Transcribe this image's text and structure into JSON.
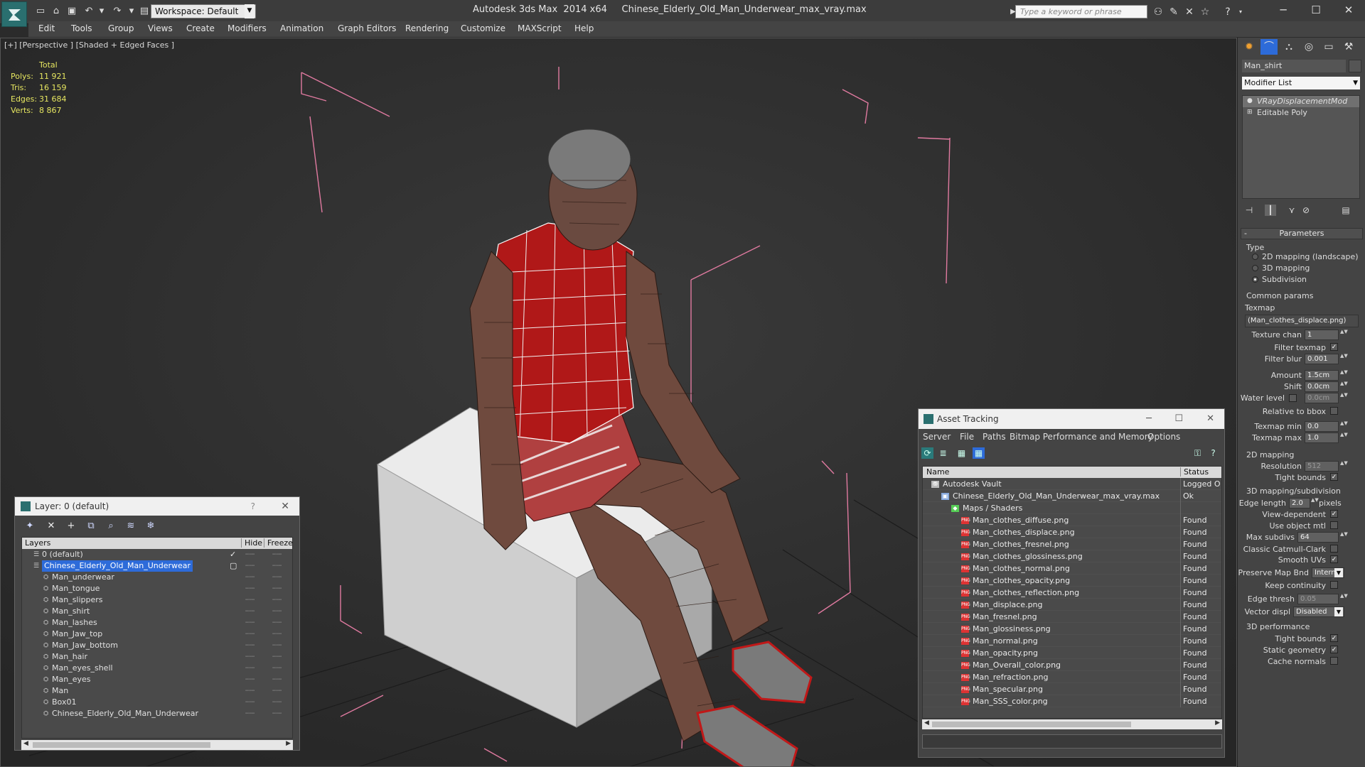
{
  "titlebar": {
    "workspace": "Workspace: Default",
    "app_title": "Autodesk 3ds Max  2014 x64     Chinese_Elderly_Old_Man_Underwear_max_vray.max",
    "search_placeholder": "Type a keyword or phrase"
  },
  "menu": [
    "Edit",
    "Tools",
    "Group",
    "Views",
    "Create",
    "Modifiers",
    "Animation",
    "Graph Editors",
    "Rendering",
    "Customize",
    "MAXScript",
    "Help"
  ],
  "viewport": {
    "label": "[+] [Perspective ] [Shaded + Edged Faces ]",
    "stats": {
      "total_label": "Total",
      "rows": [
        {
          "label": "Polys:",
          "value": "11 921"
        },
        {
          "label": "Tris:",
          "value": "16 159"
        },
        {
          "label": "Edges:",
          "value": "31 684"
        },
        {
          "label": "Verts:",
          "value": "8 867"
        }
      ]
    }
  },
  "layer_dialog": {
    "title": "Layer: 0 (default)",
    "help": "?",
    "columns": {
      "layers": "Layers",
      "hide": "Hide",
      "freeze": "Freeze"
    },
    "rows": [
      {
        "name": "0 (default)",
        "level": 1,
        "checked": true
      },
      {
        "name": "Chinese_Elderly_Old_Man_Underwear",
        "level": 1,
        "selected": true
      },
      {
        "name": "Man_underwear",
        "level": 2
      },
      {
        "name": "Man_tongue",
        "level": 2
      },
      {
        "name": "Man_slippers",
        "level": 2
      },
      {
        "name": "Man_shirt",
        "level": 2
      },
      {
        "name": "Man_lashes",
        "level": 2
      },
      {
        "name": "Man_Jaw_top",
        "level": 2
      },
      {
        "name": "Man_Jaw_bottom",
        "level": 2
      },
      {
        "name": "Man_hair",
        "level": 2
      },
      {
        "name": "Man_eyes_shell",
        "level": 2
      },
      {
        "name": "Man_eyes",
        "level": 2
      },
      {
        "name": "Man",
        "level": 2
      },
      {
        "name": "Box01",
        "level": 2
      },
      {
        "name": "Chinese_Elderly_Old_Man_Underwear",
        "level": 2
      }
    ]
  },
  "asset_dialog": {
    "title": "Asset Tracking",
    "menu": [
      "Server",
      "File",
      "Paths",
      "Bitmap Performance and Memory",
      "Options"
    ],
    "columns": {
      "name": "Name",
      "status": "Status"
    },
    "rows": [
      {
        "name": "Autodesk Vault",
        "status": "Logged O",
        "level": 0,
        "icon": "vault"
      },
      {
        "name": "Chinese_Elderly_Old_Man_Underwear_max_vray.max",
        "status": "Ok",
        "level": 1,
        "icon": "max"
      },
      {
        "name": "Maps / Shaders",
        "status": "",
        "level": 2,
        "icon": "maps"
      },
      {
        "name": "Man_clothes_diffuse.png",
        "status": "Found",
        "level": 3,
        "icon": "png"
      },
      {
        "name": "Man_clothes_displace.png",
        "status": "Found",
        "level": 3,
        "icon": "png"
      },
      {
        "name": "Man_clothes_fresnel.png",
        "status": "Found",
        "level": 3,
        "icon": "png"
      },
      {
        "name": "Man_clothes_glossiness.png",
        "status": "Found",
        "level": 3,
        "icon": "png"
      },
      {
        "name": "Man_clothes_normal.png",
        "status": "Found",
        "level": 3,
        "icon": "png"
      },
      {
        "name": "Man_clothes_opacity.png",
        "status": "Found",
        "level": 3,
        "icon": "png"
      },
      {
        "name": "Man_clothes_reflection.png",
        "status": "Found",
        "level": 3,
        "icon": "png"
      },
      {
        "name": "Man_displace.png",
        "status": "Found",
        "level": 3,
        "icon": "png"
      },
      {
        "name": "Man_fresnel.png",
        "status": "Found",
        "level": 3,
        "icon": "png"
      },
      {
        "name": "Man_glossiness.png",
        "status": "Found",
        "level": 3,
        "icon": "png"
      },
      {
        "name": "Man_normal.png",
        "status": "Found",
        "level": 3,
        "icon": "png"
      },
      {
        "name": "Man_opacity.png",
        "status": "Found",
        "level": 3,
        "icon": "png"
      },
      {
        "name": "Man_Overall_color.png",
        "status": "Found",
        "level": 3,
        "icon": "png"
      },
      {
        "name": "Man_refraction.png",
        "status": "Found",
        "level": 3,
        "icon": "png"
      },
      {
        "name": "Man_specular.png",
        "status": "Found",
        "level": 3,
        "icon": "png"
      },
      {
        "name": "Man_SSS_color.png",
        "status": "Found",
        "level": 3,
        "icon": "png"
      }
    ]
  },
  "command_panel": {
    "object_name": "Man_shirt",
    "modifier_list": "Modifier List",
    "stack": [
      {
        "name": "VRayDisplacementMod",
        "selected": true
      },
      {
        "name": "Editable Poly",
        "selected": false
      }
    ],
    "parameters_title": "Parameters",
    "type_label": "Type",
    "type_options": [
      {
        "label": "2D mapping (landscape)",
        "on": false
      },
      {
        "label": "3D mapping",
        "on": false
      },
      {
        "label": "Subdivision",
        "on": true
      }
    ],
    "common_params_label": "Common params",
    "texmap_label": "Texmap",
    "texmap_value": "(Man_clothes_displace.png)",
    "texture_chan_label": "Texture chan",
    "texture_chan_value": "1",
    "filter_texmap_label": "Filter texmap",
    "filter_blur_label": "Filter blur",
    "filter_blur_value": "0.001",
    "amount_label": "Amount",
    "amount_value": "1.5cm",
    "shift_label": "Shift",
    "shift_value": "0.0cm",
    "water_level_label": "Water level",
    "water_level_value": "0.0cm",
    "relative_bbox_label": "Relative to bbox",
    "texmap_min_label": "Texmap min",
    "texmap_min_value": "0.0",
    "texmap_max_label": "Texmap max",
    "texmap_max_value": "1.0",
    "mapping2d_label": "2D mapping",
    "resolution_label": "Resolution",
    "resolution_value": "512",
    "tight_bounds_label": "Tight bounds",
    "mapping3d_label": "3D mapping/subdivision",
    "edge_length_label": "Edge length",
    "edge_length_value": "2.0",
    "pixels_label": "pixels",
    "view_dependent_label": "View-dependent",
    "use_object_mtl_label": "Use object mtl",
    "max_subdivs_label": "Max subdivs",
    "max_subdivs_value": "64",
    "classic_cc_label": "Classic Catmull-Clark",
    "smooth_uvs_label": "Smooth UVs",
    "preserve_map_label": "Preserve Map Bnd",
    "preserve_map_value": "Intern",
    "keep_continuity_label": "Keep continuity",
    "edge_thresh_label": "Edge thresh",
    "edge_thresh_value": "0.05",
    "vector_displ_label": "Vector displ",
    "vector_displ_value": "Disabled",
    "performance_label": "3D performance",
    "perf_tight_bounds_label": "Tight bounds",
    "static_geometry_label": "Static geometry",
    "cache_normals_label": "Cache normals"
  },
  "colors": {
    "accent_selection": "#2d6bd9",
    "bbox_lines": "#e07aa0",
    "shirt": "#b01818"
  }
}
